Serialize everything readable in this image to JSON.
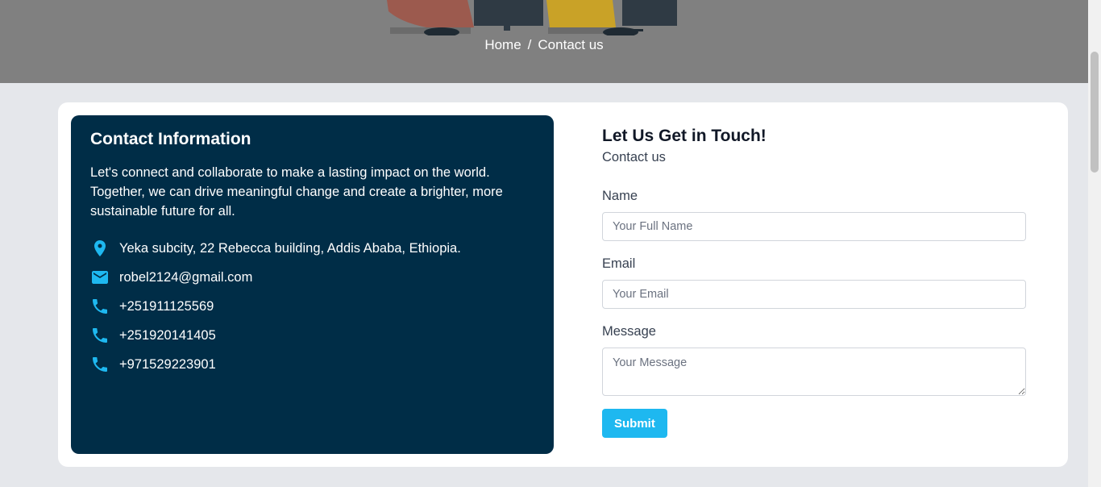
{
  "breadcrumb": {
    "home": "Home",
    "separator": "/",
    "current": "Contact us"
  },
  "colors": {
    "accent": "#1eb8f0",
    "panel": "#002d47",
    "hero": "#808080",
    "page_bg": "#e5e7eb"
  },
  "contact_info": {
    "title": "Contact Information",
    "description": "Let's connect and collaborate to make a lasting impact on the world. Together, we can drive meaningful change and create a brighter, more sustainable future for all.",
    "items": [
      {
        "icon": "location-pin-icon",
        "text": "Yeka subcity, 22 Rebecca building, Addis Ababa, Ethiopia."
      },
      {
        "icon": "mail-icon",
        "text": "robel2124@gmail.com"
      },
      {
        "icon": "phone-icon",
        "text": "+251911125569"
      },
      {
        "icon": "phone-icon",
        "text": "+251920141405"
      },
      {
        "icon": "phone-icon",
        "text": "+971529223901"
      }
    ]
  },
  "form": {
    "title": "Let Us Get in Touch!",
    "subtitle": "Contact us",
    "name_label": "Name",
    "name_placeholder": "Your Full Name",
    "email_label": "Email",
    "email_placeholder": "Your Email",
    "message_label": "Message",
    "message_placeholder": "Your Message",
    "submit_label": "Submit"
  }
}
